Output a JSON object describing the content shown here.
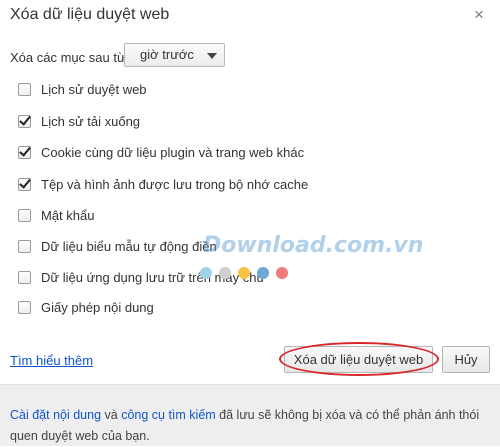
{
  "dialog": {
    "title": "Xóa dữ liệu duyệt web",
    "close_glyph": "×"
  },
  "range": {
    "label": "Xóa các mục sau từ:",
    "selected": "giờ trước"
  },
  "options": [
    {
      "label": "Lịch sử duyệt web",
      "checked": false
    },
    {
      "label": "Lịch sử tải xuống",
      "checked": true
    },
    {
      "label": "Cookie cùng dữ liệu plugin và trang web khác",
      "checked": true
    },
    {
      "label": "Tệp và hình ảnh được lưu trong bộ nhớ cache",
      "checked": true
    },
    {
      "label": "Mật khẩu",
      "checked": false
    },
    {
      "label": "Dữ liệu biểu mẫu tự động điền",
      "checked": false
    },
    {
      "label": "Dữ liệu ứng dụng lưu trữ trên máy chủ",
      "checked": false
    },
    {
      "label": "Giấy phép nội dung",
      "checked": false
    }
  ],
  "watermark": {
    "text": "Download.com.vn",
    "dot_colors": [
      "#9fd3e8",
      "#cfcfcf",
      "#f6c343",
      "#6aa8d8",
      "#ee7b7b"
    ]
  },
  "actions": {
    "learn_more": "Tìm hiểu thêm",
    "clear_label": "Xóa dữ liệu duyệt web",
    "cancel_label": "Hủy"
  },
  "footer": {
    "link1": "Cài đặt nội dung",
    "and": " và ",
    "link2": "công cụ tìm kiếm",
    "rest": " đã lưu sẽ không bị xóa và có thể phản ánh thói quen duyệt web của bạn."
  },
  "colors": {
    "link": "#1155cc",
    "highlight_ring": "#d9272e",
    "footer_bg": "#eeeeee"
  }
}
